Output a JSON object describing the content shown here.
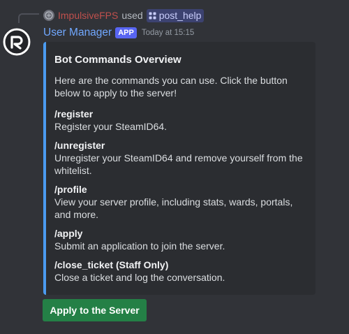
{
  "reply": {
    "username": "ImpulsiveFPS",
    "used_text": "used",
    "command": "post_help"
  },
  "message": {
    "author": "User Manager",
    "badge": "APP",
    "timestamp": "Today at 15:15"
  },
  "embed": {
    "accent_color": "#4b9bf0",
    "title": "Bot Commands Overview",
    "description": "Here are the commands you can use. Click the button below to apply to the server!",
    "fields": [
      {
        "name": "/register",
        "value": "Register your SteamID64."
      },
      {
        "name": "/unregister",
        "value": "Unregister your SteamID64 and remove yourself from the whitelist."
      },
      {
        "name": "/profile",
        "value": "View your server profile, including stats, wards, portals, and more."
      },
      {
        "name": "/apply",
        "value": "Submit an application to join the server."
      },
      {
        "name": "/close_ticket (Staff Only)",
        "value": "Close a ticket and log the conversation."
      }
    ]
  },
  "button": {
    "label": "Apply to the Server",
    "color": "#248046"
  },
  "icons": {
    "avatar": "bot-logo-icon",
    "reply_avatar": "user-avatar-icon",
    "slash_command": "slash-command-icon"
  }
}
